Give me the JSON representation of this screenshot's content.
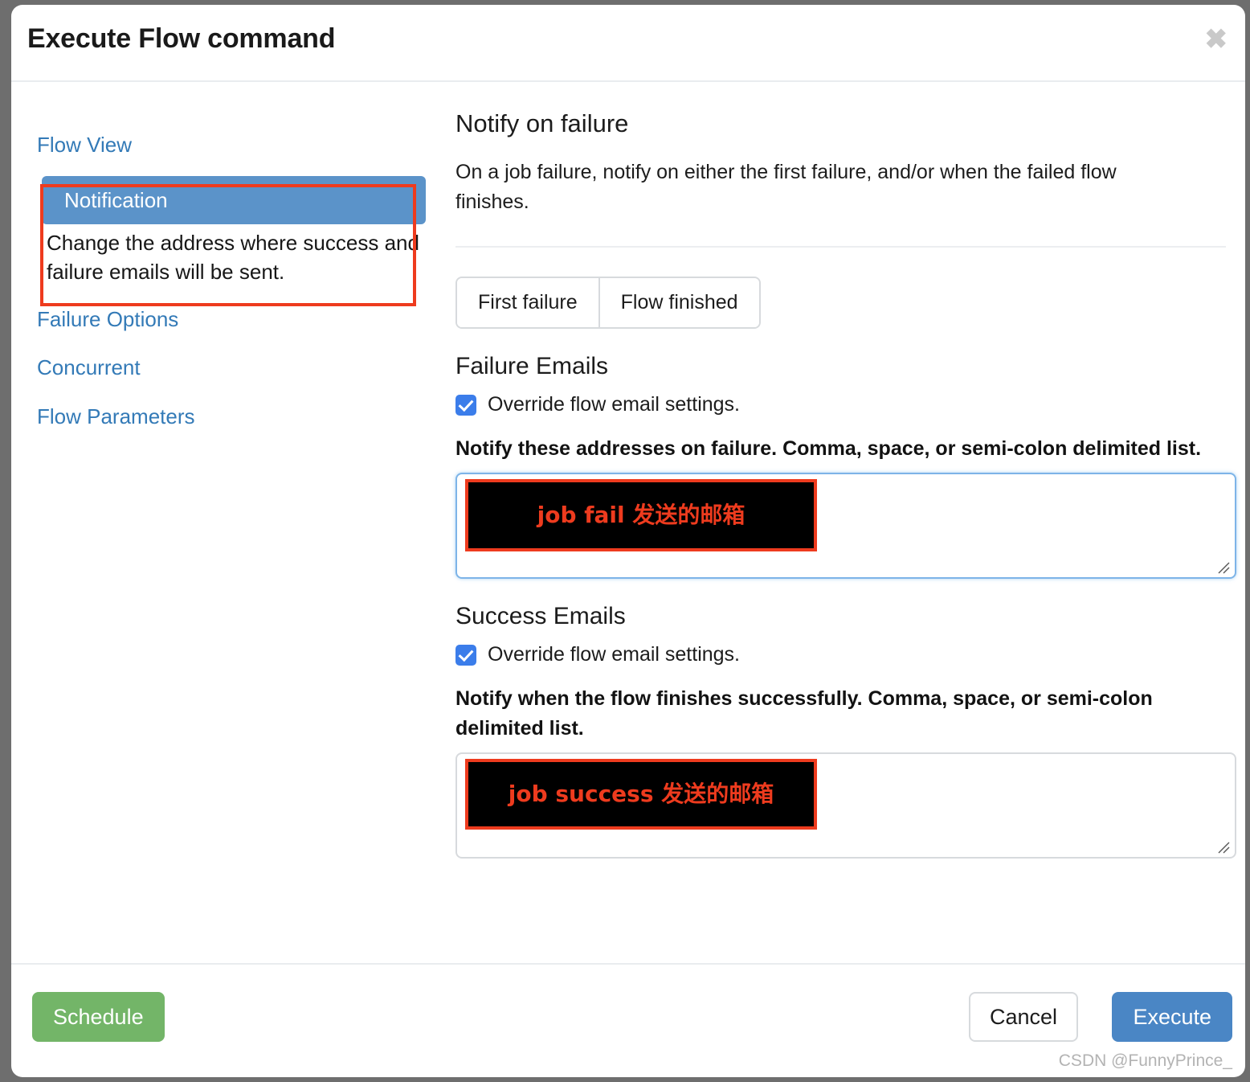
{
  "dialog": {
    "title": "Execute Flow command",
    "close_icon": "close-icon",
    "close_label": "✖"
  },
  "sidebar": {
    "items": [
      {
        "label": "Flow View",
        "name": "sidebar-item-flow-view",
        "active": false
      },
      {
        "label": "Notification",
        "name": "sidebar-item-notification",
        "active": true
      },
      {
        "label": "Failure Options",
        "name": "sidebar-item-failure-options",
        "active": false
      },
      {
        "label": "Concurrent",
        "name": "sidebar-item-concurrent",
        "active": false
      },
      {
        "label": "Flow Parameters",
        "name": "sidebar-item-flow-parameters",
        "active": false
      }
    ],
    "active_description": "Change the address where success and failure emails will be sent.",
    "annotation_color": "#ee3b1e",
    "active_bg_color": "#5b93c9",
    "link_color": "#337ab7"
  },
  "main": {
    "heading": "Notify on failure",
    "description": "On a job failure, notify on either the first failure, and/or when the failed flow finishes.",
    "toggle_buttons": [
      {
        "label": "First failure",
        "name": "first-failure-button"
      },
      {
        "label": "Flow finished",
        "name": "flow-finished-button"
      }
    ],
    "failure": {
      "heading": "Failure Emails",
      "override_label": "Override flow email settings.",
      "override_checked": true,
      "field_label": "Notify these addresses on failure. Comma, space, or semi-colon delimited list.",
      "textarea_value": "",
      "annotation_text": "job fail 发送的邮箱"
    },
    "success": {
      "heading": "Success Emails",
      "override_label": "Override flow email settings.",
      "override_checked": true,
      "field_label": "Notify when the flow finishes successfully. Comma, space, or semi-colon delimited list.",
      "textarea_value": "",
      "annotation_text": "job success 发送的邮箱"
    }
  },
  "footer": {
    "schedule_label": "Schedule",
    "cancel_label": "Cancel",
    "execute_label": "Execute",
    "watermark": "CSDN @FunnyPrince_",
    "schedule_color": "#73b568",
    "execute_color": "#4a86c5"
  }
}
